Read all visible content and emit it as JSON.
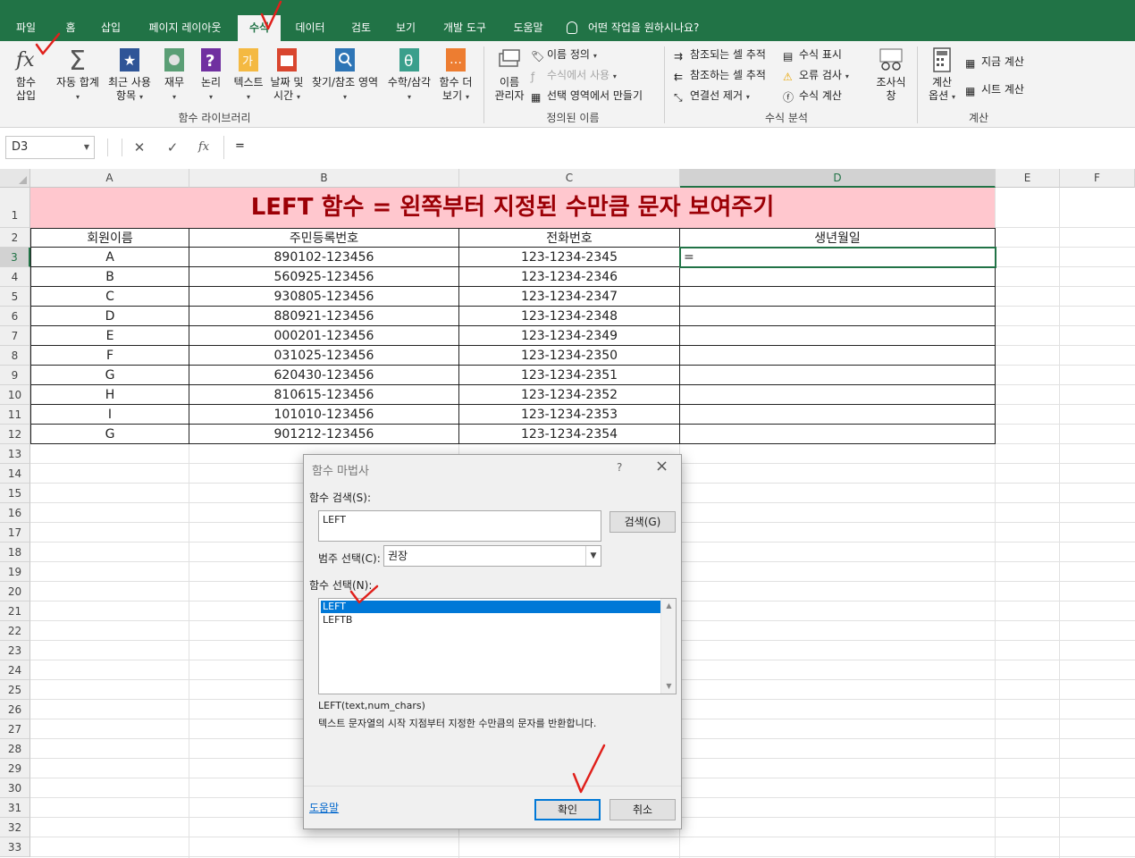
{
  "ribbon_tabs": [
    "파일",
    "홈",
    "삽입",
    "페이지 레이아웃",
    "수식",
    "데이터",
    "검토",
    "보기",
    "개발 도구",
    "도움말"
  ],
  "active_tab": "수식",
  "tell_me": "어떤 작업을 원하시나요?",
  "ribbon": {
    "insert_function": [
      "함수",
      "삽입"
    ],
    "autosum": "자동 합계",
    "recent": [
      "최근 사용",
      "항목"
    ],
    "financial": "재무",
    "logical": "논리",
    "text": "텍스트",
    "datetime": [
      "날짜 및",
      "시간"
    ],
    "lookup": "찾기/참조 영역",
    "math": "수학/삼각",
    "more": [
      "함수 더",
      "보기"
    ],
    "group_library": "함수 라이브러리",
    "name_manager": [
      "이름",
      "관리자"
    ],
    "define_name": "이름 정의",
    "use_in_formula": "수식에서 사용",
    "create_from_selection": "선택 영역에서 만들기",
    "group_names": "정의된 이름",
    "trace_precedents": "참조되는 셀 추적",
    "trace_dependents": "참조하는 셀 추적",
    "remove_arrows": "연결선 제거",
    "show_formulas": "수식 표시",
    "error_checking": "오류 검사",
    "evaluate_formula": "수식 계산",
    "watch_window": [
      "조사식",
      "창"
    ],
    "group_auditing": "수식 분석",
    "calc_options": [
      "계산",
      "옵션"
    ],
    "calc_now": "지금 계산",
    "calc_sheet": "시트 계산",
    "group_calc": "계산"
  },
  "formula_bar": {
    "name_box": "D3",
    "formula": "=",
    "fx": "fx"
  },
  "sheet": {
    "columns": [
      "A",
      "B",
      "C",
      "D",
      "E",
      "F"
    ],
    "rows": [
      "1",
      "2",
      "3",
      "4",
      "5",
      "6",
      "7",
      "8",
      "9",
      "10",
      "11",
      "12",
      "13",
      "14",
      "15",
      "16",
      "17",
      "18",
      "19",
      "20",
      "21",
      "22",
      "23",
      "24",
      "25",
      "26",
      "27",
      "28",
      "29",
      "30",
      "31",
      "32",
      "33"
    ],
    "title": "LEFT 함수 = 왼쪽부터 지정된 수만큼 문자 보여주기",
    "headers": [
      "회원이름",
      "주민등록번호",
      "전화번호",
      "생년월일"
    ],
    "data": [
      [
        "A",
        "890102-123456",
        "123-1234-2345",
        "="
      ],
      [
        "B",
        "560925-123456",
        "123-1234-2346",
        ""
      ],
      [
        "C",
        "930805-123456",
        "123-1234-2347",
        ""
      ],
      [
        "D",
        "880921-123456",
        "123-1234-2348",
        ""
      ],
      [
        "E",
        "000201-123456",
        "123-1234-2349",
        ""
      ],
      [
        "F",
        "031025-123456",
        "123-1234-2350",
        ""
      ],
      [
        "G",
        "620430-123456",
        "123-1234-2351",
        ""
      ],
      [
        "H",
        "810615-123456",
        "123-1234-2352",
        ""
      ],
      [
        "I",
        "101010-123456",
        "123-1234-2353",
        ""
      ],
      [
        "G",
        "901212-123456",
        "123-1234-2354",
        ""
      ]
    ]
  },
  "dialog": {
    "title": "함수 마법사",
    "help_q": "?",
    "search_label": "함수 검색(S):",
    "search_value": "LEFT",
    "search_button": "검색(G)",
    "category_label": "범주 선택(C):",
    "category_value": "권장",
    "select_label": "함수 선택(N):",
    "functions": [
      "LEFT",
      "LEFTB"
    ],
    "selected_function": "LEFT",
    "signature": "LEFT(text,num_chars)",
    "description": "텍스트 문자열의 시작 지점부터 지정한 수만큼의 문자를 반환합니다.",
    "help_link": "도움말",
    "ok": "확인",
    "cancel": "취소"
  },
  "colors": {
    "excel_green": "#217346",
    "title_fill": "#ffc7ce",
    "title_text": "#9c0006",
    "selection_blue": "#0078d7",
    "annotation_red": "#e0201b"
  }
}
